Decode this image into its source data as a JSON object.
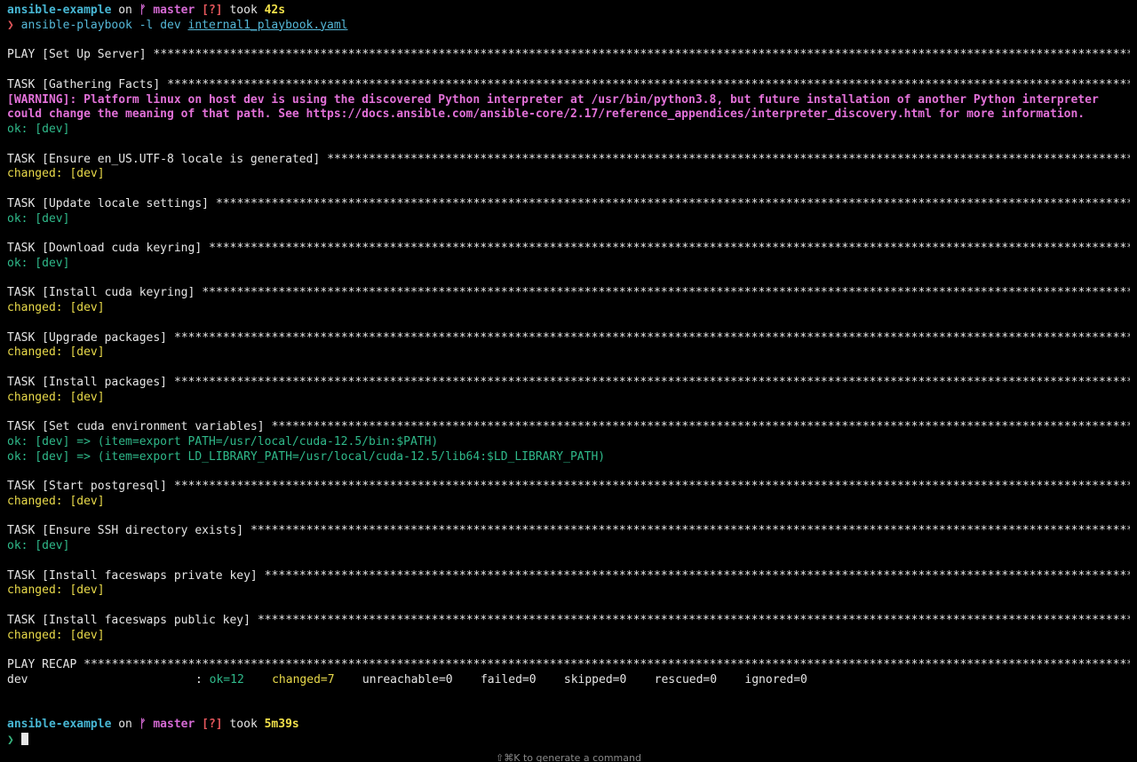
{
  "prompt_top": {
    "dir": "ansible-example",
    "on": "on",
    "branch_icon": "git-branch-icon",
    "branch_glyph": "ᚠ",
    "branch": "master",
    "status": "[?]",
    "took": "took",
    "duration": "42s"
  },
  "command": {
    "prompt_char": "❯",
    "cmd": "ansible-playbook -l dev ",
    "file": "internal1_playbook.yaml"
  },
  "play": {
    "label": "PLAY [Set Up Server]",
    "stars": "****************************************************************************************************************************************************************"
  },
  "tasks": [
    {
      "label": "TASK [Gathering Facts]",
      "warning": [
        "[WARNING]: Platform linux on host dev is using the discovered Python interpreter at /usr/bin/python3.8, but future installation of another Python interpreter",
        "could change the meaning of that path. See https://docs.ansible.com/ansible-core/2.17/reference_appendices/interpreter_discovery.html for more information."
      ],
      "results": [
        {
          "status": "ok",
          "text": "ok: [dev]"
        }
      ]
    },
    {
      "label": "TASK [Ensure en_US.UTF-8 locale is generated]",
      "results": [
        {
          "status": "changed",
          "text": "changed: [dev]"
        }
      ]
    },
    {
      "label": "TASK [Update locale settings]",
      "results": [
        {
          "status": "ok",
          "text": "ok: [dev]"
        }
      ]
    },
    {
      "label": "TASK [Download cuda keyring]",
      "results": [
        {
          "status": "ok",
          "text": "ok: [dev]"
        }
      ]
    },
    {
      "label": "TASK [Install cuda keyring]",
      "results": [
        {
          "status": "changed",
          "text": "changed: [dev]"
        }
      ]
    },
    {
      "label": "TASK [Upgrade packages]",
      "results": [
        {
          "status": "changed",
          "text": "changed: [dev]"
        }
      ]
    },
    {
      "label": "TASK [Install packages]",
      "results": [
        {
          "status": "changed",
          "text": "changed: [dev]"
        }
      ]
    },
    {
      "label": "TASK [Set cuda environment variables]",
      "results": [
        {
          "status": "ok",
          "text": "ok: [dev] => (item=export PATH=/usr/local/cuda-12.5/bin:$PATH)"
        },
        {
          "status": "ok",
          "text": "ok: [dev] => (item=export LD_LIBRARY_PATH=/usr/local/cuda-12.5/lib64:$LD_LIBRARY_PATH)"
        }
      ]
    },
    {
      "label": "TASK [Start postgresql]",
      "results": [
        {
          "status": "changed",
          "text": "changed: [dev]"
        }
      ]
    },
    {
      "label": "TASK [Ensure SSH directory exists]",
      "results": [
        {
          "status": "ok",
          "text": "ok: [dev]"
        }
      ]
    },
    {
      "label": "TASK [Install faceswaps private key]",
      "results": [
        {
          "status": "changed",
          "text": "changed: [dev]"
        }
      ]
    },
    {
      "label": "TASK [Install faceswaps public key]",
      "results": [
        {
          "status": "changed",
          "text": "changed: [dev]"
        }
      ]
    }
  ],
  "recap": {
    "label": "PLAY RECAP",
    "host": "dev",
    "sep": ": ",
    "ok": "ok=12",
    "changed": "changed=7",
    "unreachable": "unreachable=0",
    "failed": "failed=0",
    "skipped": "skipped=0",
    "rescued": "rescued=0",
    "ignored": "ignored=0"
  },
  "prompt_bottom": {
    "dir": "ansible-example",
    "on": "on",
    "branch_glyph": "ᚠ",
    "branch": "master",
    "status": "[?]",
    "took": "took",
    "duration": "5m39s",
    "prompt_char": "❯"
  },
  "hint": "⇧⌘K to generate a command",
  "colors": {
    "background": "#000000",
    "dir": "#47b6d3",
    "branch": "#d56ad4",
    "status": "#e0555a",
    "duration": "#f1e04a",
    "ok": "#2fb98a",
    "changed": "#e8d94a",
    "warning": "#e271d8"
  }
}
